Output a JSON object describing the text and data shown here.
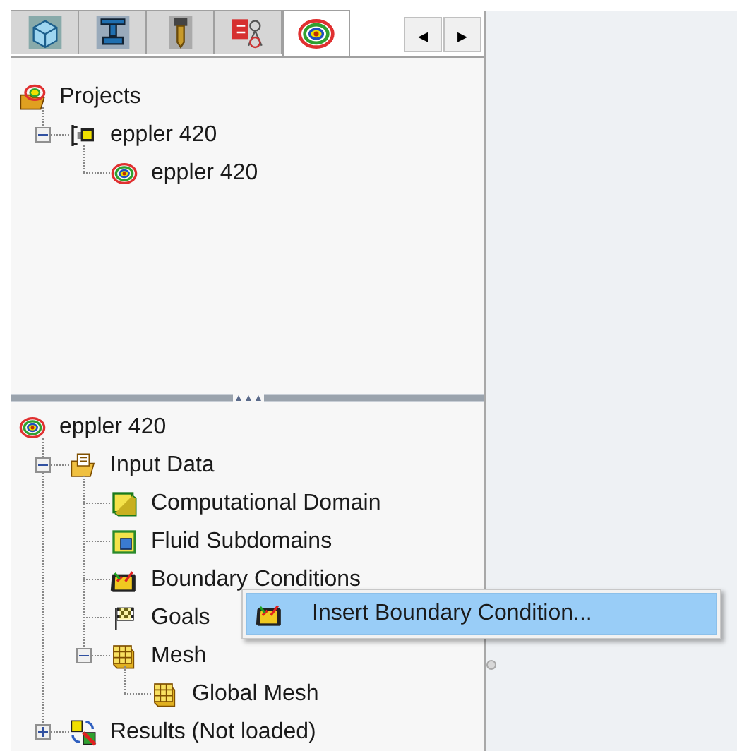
{
  "tabs": [
    {
      "kind": "part",
      "selected": false
    },
    {
      "kind": "press",
      "selected": false
    },
    {
      "kind": "drill",
      "selected": false
    },
    {
      "kind": "simulation",
      "selected": false
    },
    {
      "kind": "flow",
      "selected": true
    }
  ],
  "tab_scroll": {
    "left": "◂",
    "right": "▸"
  },
  "project_tree": [
    {
      "label": "Projects",
      "kind": "projects",
      "children": [
        {
          "label": "eppler 420",
          "kind": "config",
          "expanded": true,
          "children": [
            {
              "label": "eppler 420",
              "kind": "flow"
            }
          ]
        }
      ]
    }
  ],
  "analysis_tree": [
    {
      "label": "eppler 420",
      "kind": "flow",
      "children": [
        {
          "label": "Input Data",
          "kind": "folder",
          "expanded": true,
          "children": [
            {
              "label": "Computational Domain",
              "kind": "domain"
            },
            {
              "label": "Fluid Subdomains",
              "kind": "subdomain"
            },
            {
              "label": "Boundary Conditions",
              "kind": "boundary"
            },
            {
              "label": "Goals",
              "kind": "goals"
            },
            {
              "label": "Mesh",
              "kind": "mesh",
              "expanded": true,
              "children": [
                {
                  "label": "Global Mesh",
                  "kind": "mesh"
                }
              ]
            }
          ]
        },
        {
          "label": "Results (Not loaded)",
          "kind": "results",
          "expanded": false
        }
      ]
    }
  ],
  "context_menu": [
    {
      "label": "Insert Boundary Condition...",
      "kind": "boundary",
      "selected": true
    }
  ]
}
